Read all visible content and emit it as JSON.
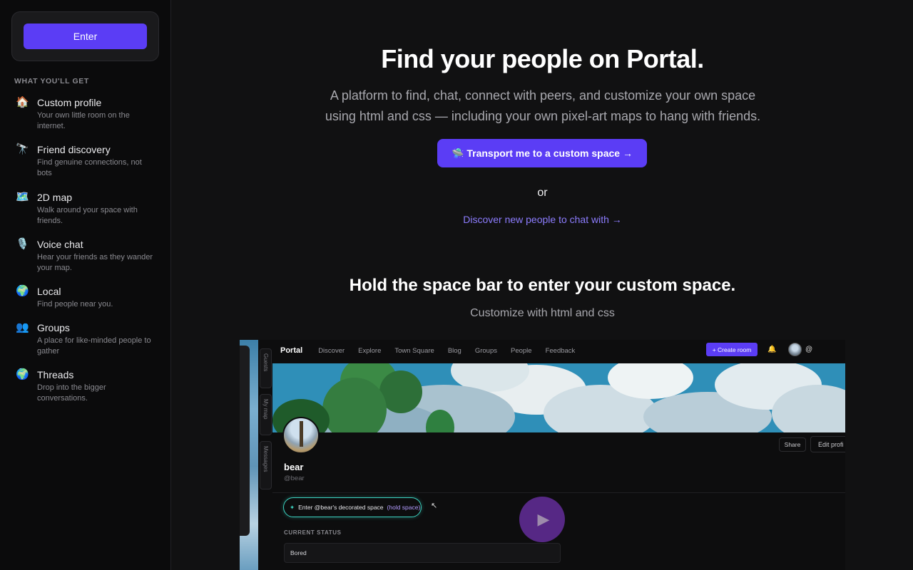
{
  "sidebar": {
    "enter_label": "Enter",
    "section_title": "WHAT YOU'LL GET",
    "features": [
      {
        "icon": "🏠",
        "title": "Custom profile",
        "desc": "Your own little room on the internet."
      },
      {
        "icon": "🔭",
        "title": "Friend discovery",
        "desc": "Find genuine connections, not bots"
      },
      {
        "icon": "🗺️",
        "title": "2D map",
        "desc": "Walk around your space with friends."
      },
      {
        "icon": "🎙️",
        "title": "Voice chat",
        "desc": "Hear your friends as they wander your map."
      },
      {
        "icon": "🌍",
        "title": "Local",
        "desc": "Find people near you."
      },
      {
        "icon": "👥",
        "title": "Groups",
        "desc": "A place for like-minded people to gather"
      },
      {
        "icon": "🌍",
        "title": "Threads",
        "desc": "Drop into the bigger conversations."
      }
    ]
  },
  "hero": {
    "title": "Find your people on Portal.",
    "subtitle": "A platform to find, chat, connect with peers, and customize your own space using html and css — including your own pixel-art maps to hang with friends.",
    "cta_label": "🛸 Transport me to a custom space →",
    "or_label": "or",
    "discover_label": "Discover new people to chat with →"
  },
  "section2": {
    "title": "Hold the space bar to enter your custom space.",
    "subtitle": "Customize with html and css"
  },
  "preview": {
    "side_tabs": [
      "Guests",
      "My map",
      "Messages"
    ],
    "brand": "Portal",
    "nav_links": [
      "Discover",
      "Explore",
      "Town Square",
      "Blog",
      "Groups",
      "People",
      "Feedback"
    ],
    "create_room_label": "+ Create room",
    "nav_at": "@",
    "share_label": "Share",
    "edit_label": "Edit profi",
    "profile_name": "bear",
    "profile_handle": "@bear",
    "enter_space_label": "Enter @bear's decorated space",
    "enter_space_hint": "(hold space)",
    "status_label": "CURRENT STATUS",
    "status_value": "Bored"
  },
  "colors": {
    "accent": "#5b3df5",
    "link": "#8d7dff",
    "teal": "#3cd3c1",
    "background": "#111112"
  }
}
